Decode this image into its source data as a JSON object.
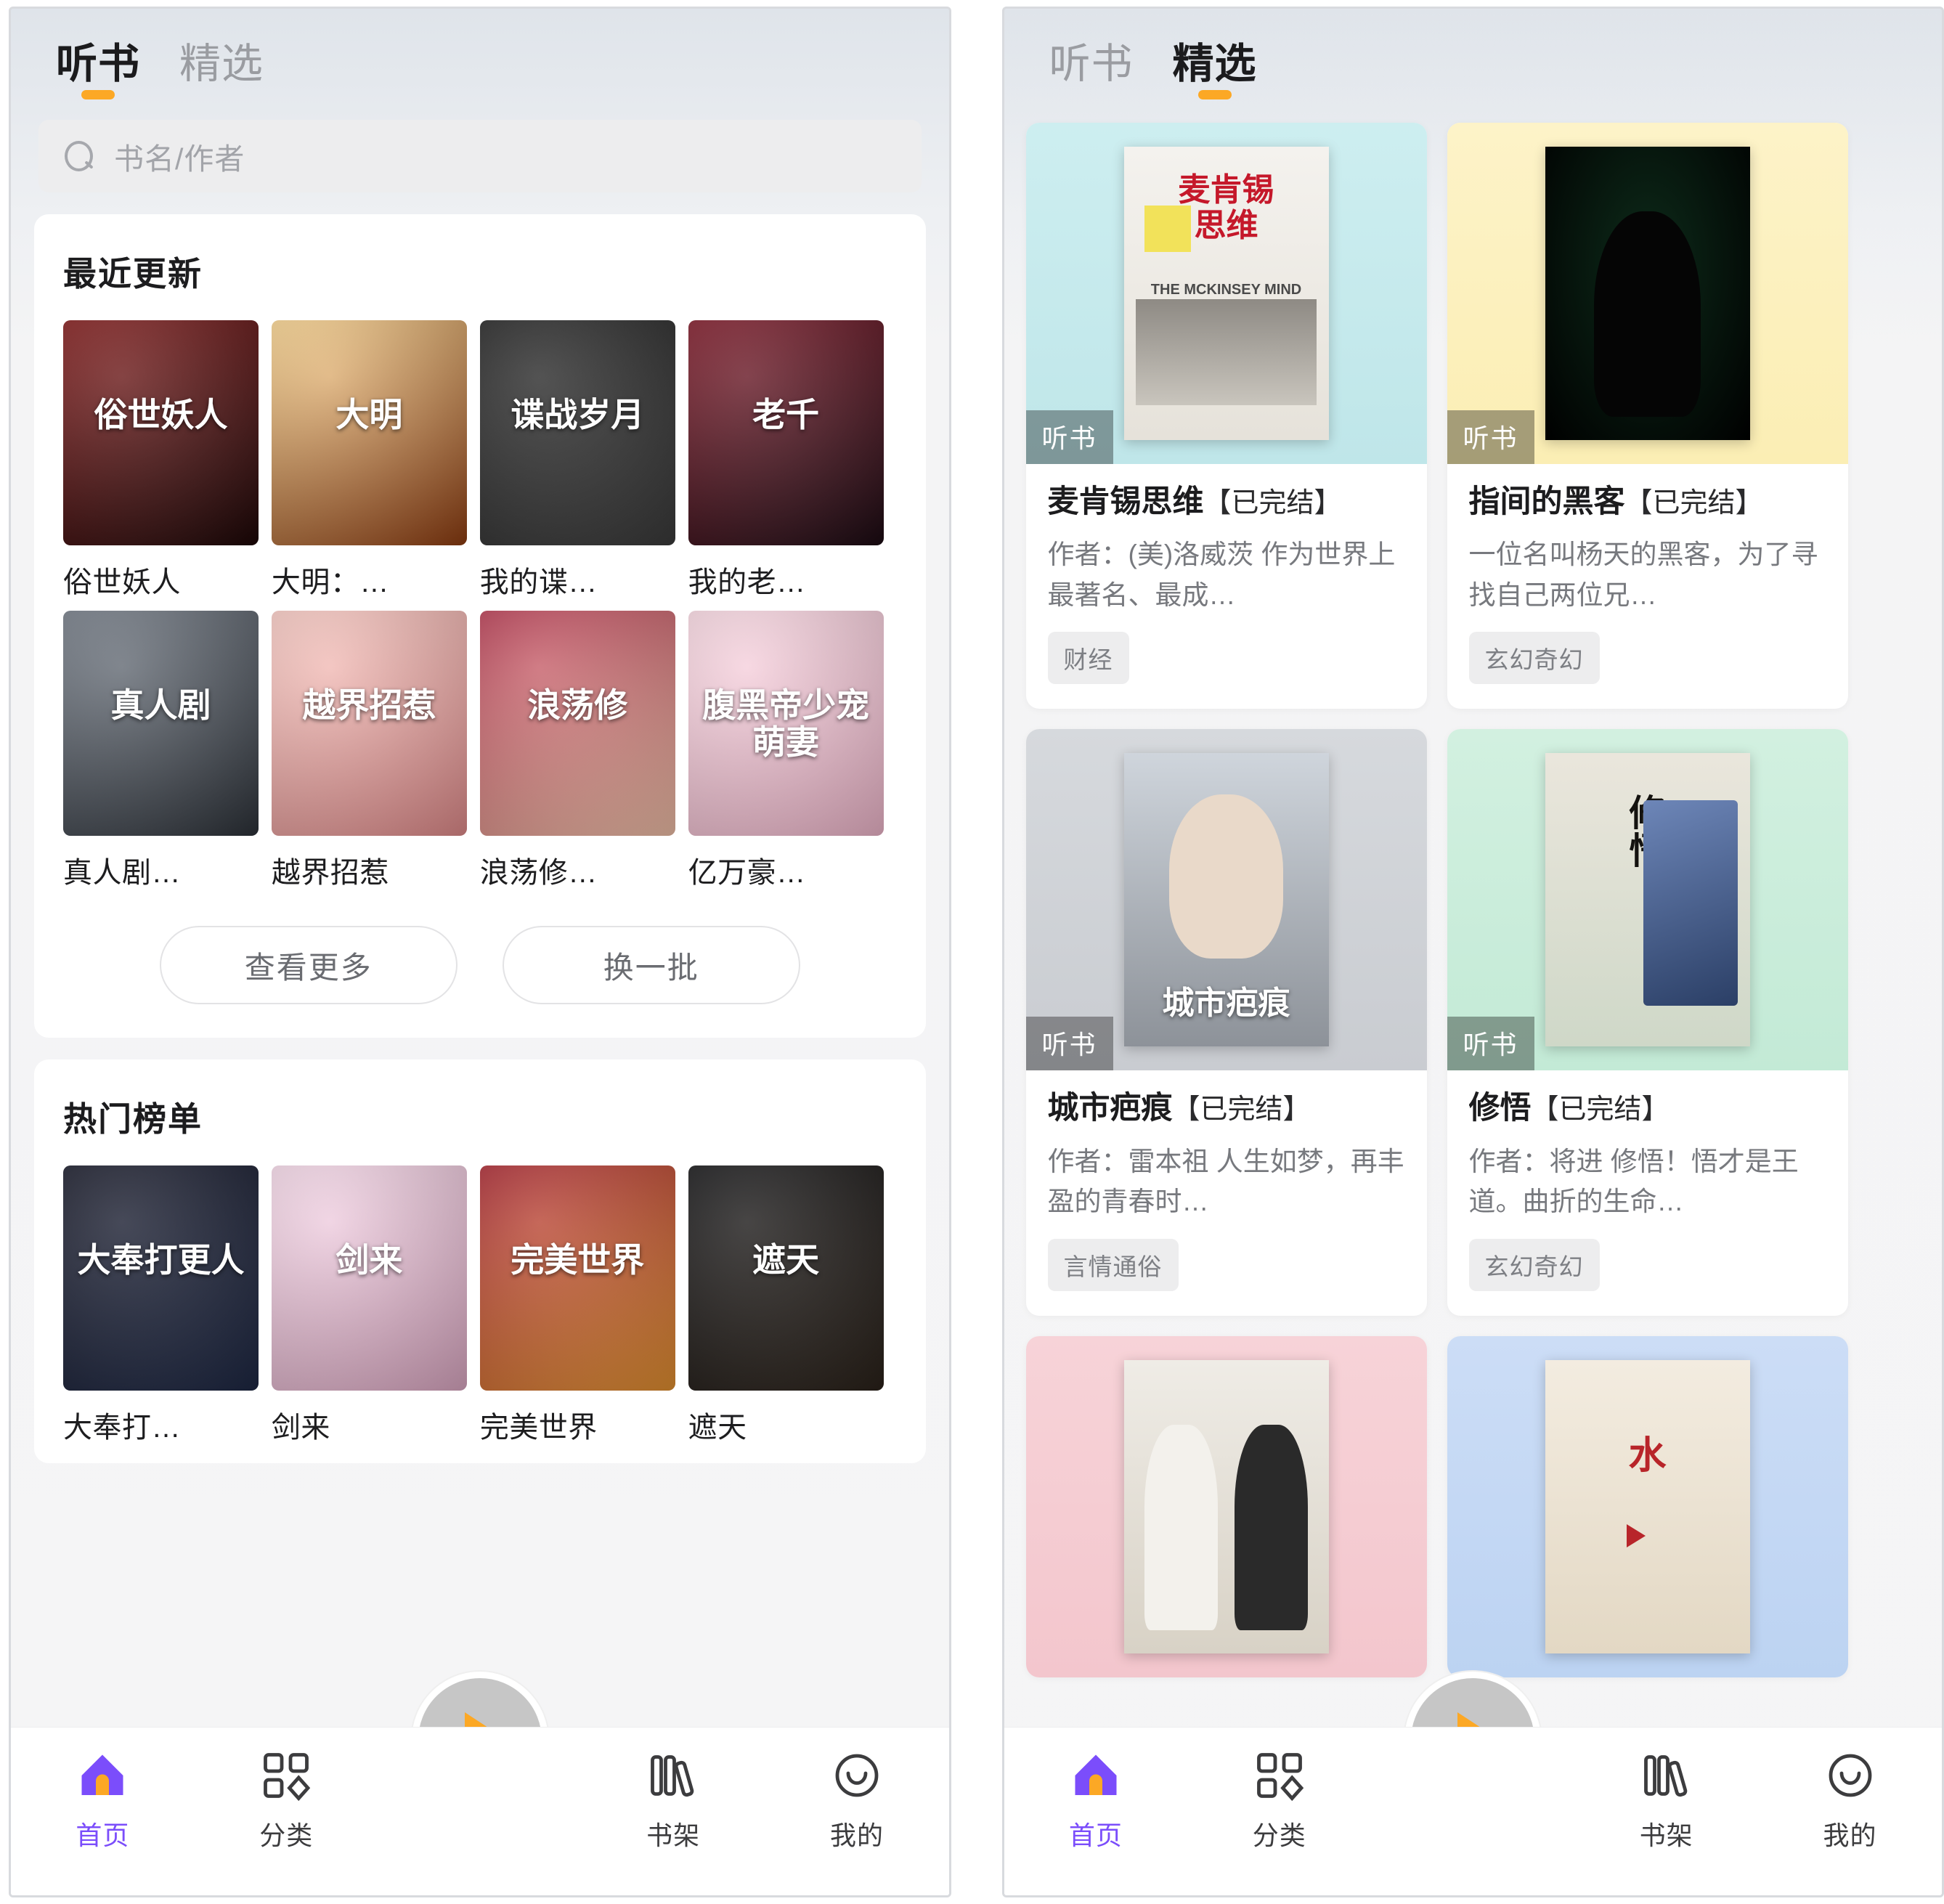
{
  "left_screen": {
    "tabs": [
      {
        "label": "听书",
        "active": true
      },
      {
        "label": "精选",
        "active": false
      }
    ],
    "search": {
      "placeholder": "书名/作者",
      "icon": "search-icon"
    },
    "sections": [
      {
        "title": "最近更新",
        "books": [
          {
            "name": "俗世妖人",
            "cover_text": "俗世妖人",
            "c1": "#7d1212",
            "c2": "#1b0606"
          },
          {
            "name": "大明：…",
            "cover_text": "大明",
            "c1": "#f6d08a",
            "c2": "#8c3b10"
          },
          {
            "name": "我的谍…",
            "cover_text": "谍战岁月",
            "c1": "#1a1a1a",
            "c2": "#3a3a3a"
          },
          {
            "name": "我的老…",
            "cover_text": "老千",
            "c1": "#7a1020",
            "c2": "#1a0a12"
          },
          {
            "name": "真人剧…",
            "cover_text": "真人剧",
            "c1": "#6e7681",
            "c2": "#2c3138"
          },
          {
            "name": "越界招惹",
            "cover_text": "越界招惹",
            "c1": "#f6c7c0",
            "c2": "#e08a8a"
          },
          {
            "name": "浪荡修…",
            "cover_text": "浪荡修",
            "c1": "#b3324a",
            "c2": "#f0c0a8"
          },
          {
            "name": "亿万豪…",
            "cover_text": "腹黑帝少宠萌妻",
            "c1": "#f7d6e0",
            "c2": "#efb6cb"
          }
        ],
        "buttons": [
          {
            "label": "查看更多"
          },
          {
            "label": "换一批"
          }
        ]
      },
      {
        "title": "热门榜单",
        "books": [
          {
            "name": "大奉打…",
            "cover_text": "大奉打更人",
            "c1": "#0e1020",
            "c2": "#1d2743"
          },
          {
            "name": "剑来",
            "cover_text": "剑来",
            "c1": "#f3d6e6",
            "c2": "#dba7c2"
          },
          {
            "name": "完美世界",
            "cover_text": "完美世界",
            "c1": "#a51f2a",
            "c2": "#e2902f"
          },
          {
            "name": "遮天",
            "cover_text": "遮天",
            "c1": "#0b0b0d",
            "c2": "#2a2119"
          }
        ]
      }
    ],
    "fab": {
      "icon": "play-icon"
    },
    "bottom_nav": [
      {
        "label": "首页",
        "icon": "home-icon",
        "active": true
      },
      {
        "label": "分类",
        "icon": "category-icon",
        "active": false
      },
      {
        "label": "书架",
        "icon": "bookshelf-icon",
        "active": false
      },
      {
        "label": "我的",
        "icon": "profile-icon",
        "active": false
      }
    ]
  },
  "right_screen": {
    "tabs": [
      {
        "label": "听书",
        "active": false
      },
      {
        "label": "精选",
        "active": true
      }
    ],
    "cards": [
      {
        "title": "麦肯锡思维",
        "status": "【已完结】",
        "desc": "作者：(美)洛威茨 作为世界上最著名、最成…",
        "tag": "财经",
        "badge": "听书",
        "bg": "#cdeef0",
        "bg2": "#bfe6e9",
        "cover_kind": "mckinsey"
      },
      {
        "title": "指间的黑客",
        "status": "【已完结】",
        "desc": "一位名叫杨天的黑客，为了寻找自己两位兄…",
        "tag": "玄幻奇幻",
        "badge": "听书",
        "bg": "#fdf3c8",
        "bg2": "#fbeeb4",
        "cover_kind": "hacker"
      },
      {
        "title": "城市疤痕",
        "status": "【已完结】",
        "desc": "作者：雷本祖 人生如梦，再丰盈的青春时…",
        "tag": "言情通俗",
        "badge": "听书",
        "bg": "#d6d9dd",
        "bg2": "#c9ccd1",
        "cover_kind": "city"
      },
      {
        "title": "修悟",
        "status": "【已完结】",
        "desc": "作者：将进 修悟！悟才是王道。曲折的生命…",
        "tag": "玄幻奇幻",
        "badge": "听书",
        "bg": "#d2f0e0",
        "bg2": "#c3ead6",
        "cover_kind": "xiuwu"
      },
      {
        "title": "",
        "status": "",
        "desc": "",
        "tag": "",
        "badge": "",
        "bg": "#f7d3d8",
        "bg2": "#f3c6cd",
        "cover_kind": "xiangsheng"
      },
      {
        "title": "",
        "status": "",
        "desc": "",
        "tag": "",
        "badge": "",
        "bg": "#ccddf6",
        "bg2": "#bcd3f2",
        "cover_kind": "shui"
      }
    ],
    "fab": {
      "icon": "play-icon"
    },
    "bottom_nav": [
      {
        "label": "首页",
        "icon": "home-icon",
        "active": true
      },
      {
        "label": "分类",
        "icon": "category-icon",
        "active": false
      },
      {
        "label": "书架",
        "icon": "bookshelf-icon",
        "active": false
      },
      {
        "label": "我的",
        "icon": "profile-icon",
        "active": false
      }
    ]
  },
  "colors": {
    "accent_orange": "#fca825",
    "accent_purple": "#7b4dfb",
    "text_primary": "#1c1c1e",
    "text_muted": "#9a9ca1"
  }
}
